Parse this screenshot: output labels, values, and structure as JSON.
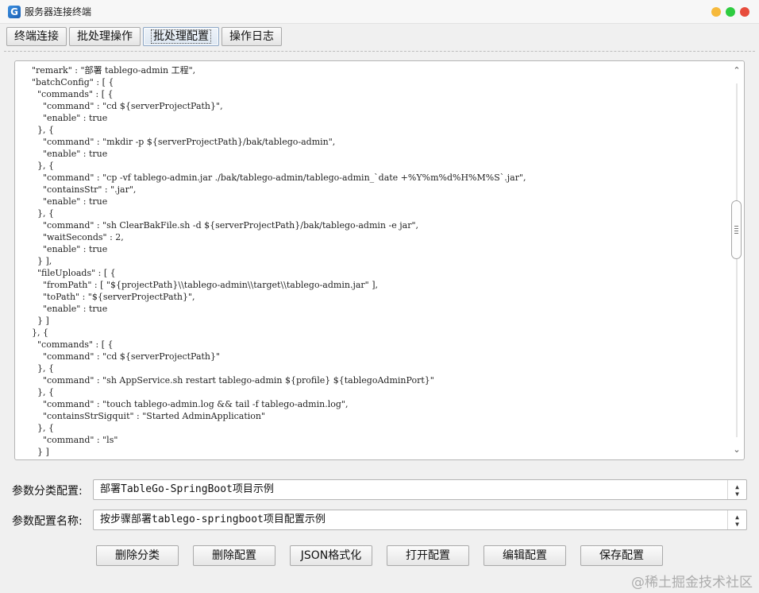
{
  "window": {
    "title": "服务器连接终端"
  },
  "tabs": [
    {
      "label": "终端连接"
    },
    {
      "label": "批处理操作"
    },
    {
      "label": "批处理配置"
    },
    {
      "label": "操作日志"
    }
  ],
  "editor": {
    "lines": [
      "      \"remark\" : \"部署 tablego-admin 工程\",",
      "      \"batchConfig\" : [ {",
      "        \"commands\" : [ {",
      "          \"command\" : \"cd ${serverProjectPath}\",",
      "          \"enable\" : true",
      "        }, {",
      "          \"command\" : \"mkdir -p ${serverProjectPath}/bak/tablego-admin\",",
      "          \"enable\" : true",
      "        }, {",
      "          \"command\" : \"cp -vf tablego-admin.jar ./bak/tablego-admin/tablego-admin_`date +%Y%m%d%H%M%S`.jar\",",
      "          \"containsStr\" : \".jar\",",
      "          \"enable\" : true",
      "        }, {",
      "          \"command\" : \"sh ClearBakFile.sh -d ${serverProjectPath}/bak/tablego-admin -e jar\",",
      "          \"waitSeconds\" : 2,",
      "          \"enable\" : true",
      "        } ],",
      "        \"fileUploads\" : [ {",
      "          \"fromPath\" : [ \"${projectPath}\\\\tablego-admin\\\\target\\\\tablego-admin.jar\" ],",
      "          \"toPath\" : \"${serverProjectPath}\",",
      "          \"enable\" : true",
      "        } ]",
      "      }, {",
      "        \"commands\" : [ {",
      "          \"command\" : \"cd ${serverProjectPath}\"",
      "        }, {",
      "          \"command\" : \"sh AppService.sh restart tablego-admin ${profile} ${tablegoAdminPort}\"",
      "        }, {",
      "          \"command\" : \"touch tablego-admin.log && tail -f tablego-admin.log\",",
      "          \"containsStrSigquit\" : \"Started AdminApplication\"",
      "        }, {",
      "          \"command\" : \"ls\"",
      "        } ]"
    ]
  },
  "form": {
    "category_label": "参数分类配置:",
    "category_value": "部署TableGo-SpringBoot项目示例",
    "name_label": "参数配置名称:",
    "name_value": "按步骤部署tablego-springboot项目配置示例"
  },
  "buttons": {
    "delete_category": "删除分类",
    "delete_config": "删除配置",
    "json_format": "JSON格式化",
    "open_config": "打开配置",
    "edit_config": "编辑配置",
    "save_config": "保存配置"
  },
  "watermark": "@稀土掘金技术社区"
}
